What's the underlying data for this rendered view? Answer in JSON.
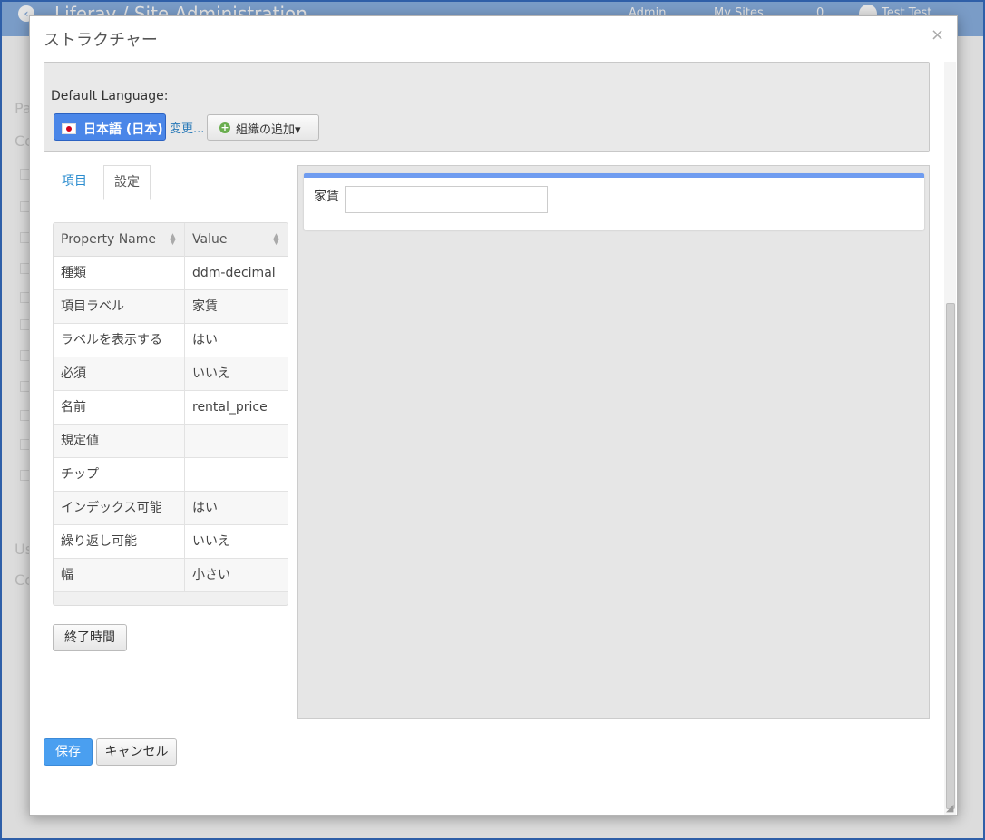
{
  "background": {
    "brand": "Liferay  /  Site Administration",
    "nav": [
      "Admin",
      "My Sites",
      "0",
      "Test Test"
    ],
    "sidebar_letters": [
      "Pa",
      "Co",
      "Us",
      "Co"
    ]
  },
  "modal": {
    "title": "ストラクチャー",
    "close": "×"
  },
  "language": {
    "label": "Default Language:",
    "current": "日本語 (日本)",
    "change_link": "変更...",
    "add_org": "組織の追加▾"
  },
  "tabs": [
    "項目",
    "設定"
  ],
  "property_table": {
    "headers": [
      "Property Name",
      "Value"
    ],
    "rows": [
      {
        "name": "種類",
        "value": "ddm-decimal"
      },
      {
        "name": "項目ラベル",
        "value": "家賃"
      },
      {
        "name": "ラベルを表示する",
        "value": "はい"
      },
      {
        "name": "必須",
        "value": "いいえ"
      },
      {
        "name": "名前",
        "value": "rental_price"
      },
      {
        "name": "規定値",
        "value": ""
      },
      {
        "name": "チップ",
        "value": ""
      },
      {
        "name": "インデックス可能",
        "value": "はい"
      },
      {
        "name": "繰り返し可能",
        "value": "いいえ"
      },
      {
        "name": "幅",
        "value": "小さい"
      }
    ]
  },
  "end_button": "終了時間",
  "canvas": {
    "field_label": "家賃",
    "field_value": ""
  },
  "footer": {
    "save": "保存",
    "cancel": "キャンセル"
  }
}
